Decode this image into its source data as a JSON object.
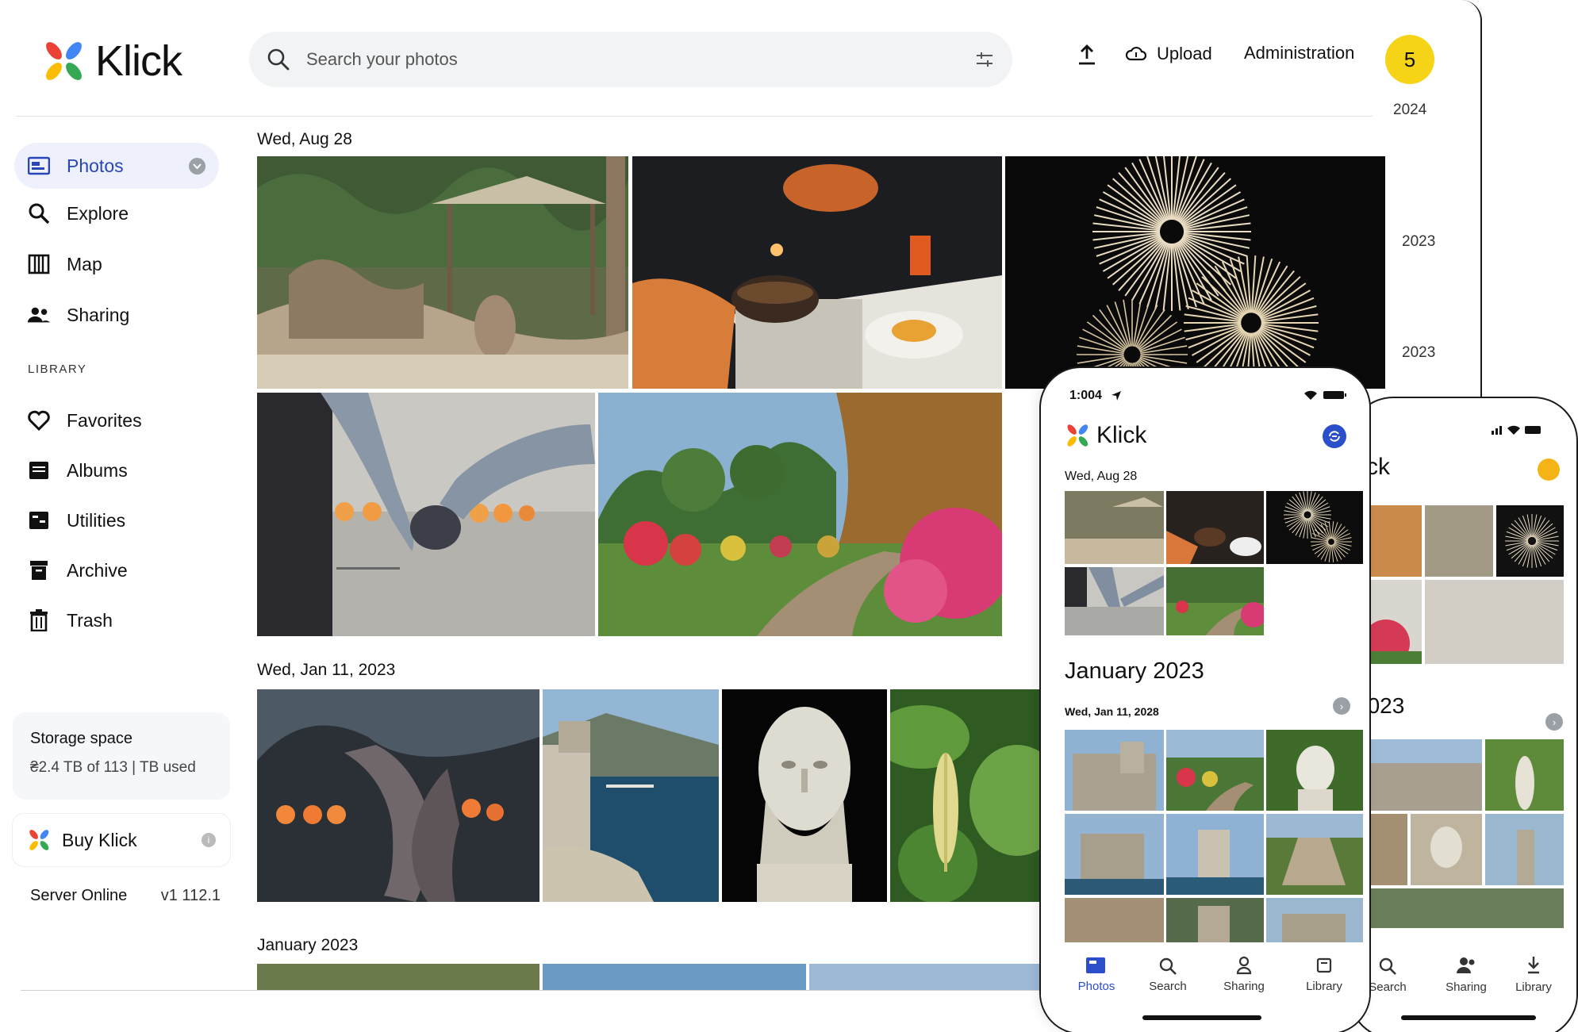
{
  "app": {
    "brand": "Klick"
  },
  "header": {
    "search_placeholder": "Search your photos",
    "upload_label": "Upload",
    "admin_label": "Administration",
    "avatar_initial": "5"
  },
  "sidebar": {
    "items": [
      {
        "label": "Photos",
        "icon": "photos-icon"
      },
      {
        "label": "Explore",
        "icon": "search-icon"
      },
      {
        "label": "Map",
        "icon": "map-icon"
      },
      {
        "label": "Sharing",
        "icon": "people-icon"
      }
    ],
    "library_label": "LIBRARY",
    "library_items": [
      {
        "label": "Favorites",
        "icon": "heart-icon"
      },
      {
        "label": "Albums",
        "icon": "album-icon"
      },
      {
        "label": "Utilities",
        "icon": "utilities-icon"
      },
      {
        "label": "Archive",
        "icon": "archive-icon"
      },
      {
        "label": "Trash",
        "icon": "trash-icon"
      }
    ],
    "storage_title": "Storage space",
    "storage_usage": "₴2.4 TB of 113 | TB used",
    "buy_label": "Buy Klick",
    "server_status": "Server Online",
    "server_version": "v1 112.1"
  },
  "timeline": {
    "years": [
      "2024",
      "2023",
      "2023"
    ]
  },
  "sections": [
    {
      "date": "Wed, Aug 28"
    },
    {
      "date": "Wed, Jan 11, 2023"
    },
    {
      "date": "January 2023"
    }
  ],
  "phone_a": {
    "time": "1:004",
    "brand": "Klick",
    "section1_date": "Wed, Aug 28",
    "month_title": "January 2023",
    "section2_date": "Wed, Jan 11, 2028",
    "nav": [
      "Photos",
      "Search",
      "Sharing",
      "Library"
    ]
  },
  "phone_b": {
    "brand_partial": "ck",
    "month_partial": "2023",
    "nav": [
      "Search",
      "Sharing",
      "Library"
    ]
  },
  "colors": {
    "accent": "#2b4ecb",
    "avatar": "#f5d316",
    "active_bg": "#eef1fb"
  }
}
